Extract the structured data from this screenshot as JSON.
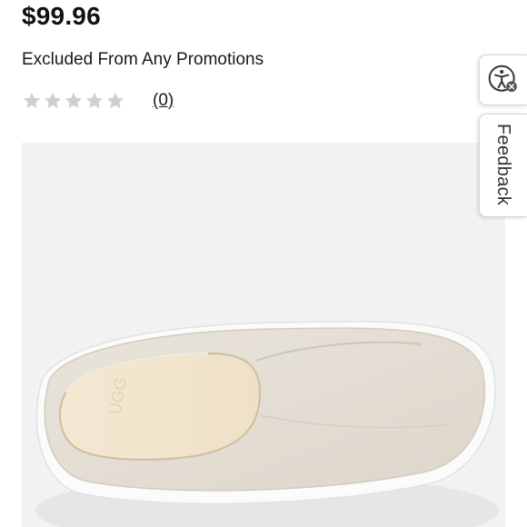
{
  "product": {
    "price": "$99.96",
    "promo_note": "Excluded From Any Promotions",
    "rating": {
      "value": 0,
      "max": 5,
      "review_count": "(0)"
    },
    "image": {
      "subject": "shoe",
      "brand_mark": "UGG"
    }
  },
  "side_widgets": {
    "accessibility": {
      "icon": "accessibility-icon"
    },
    "feedback": {
      "label": "Feedback"
    }
  },
  "colors": {
    "star_empty": "#cfcfcf",
    "image_bg": "#f2f2f2",
    "text": "#111111"
  }
}
